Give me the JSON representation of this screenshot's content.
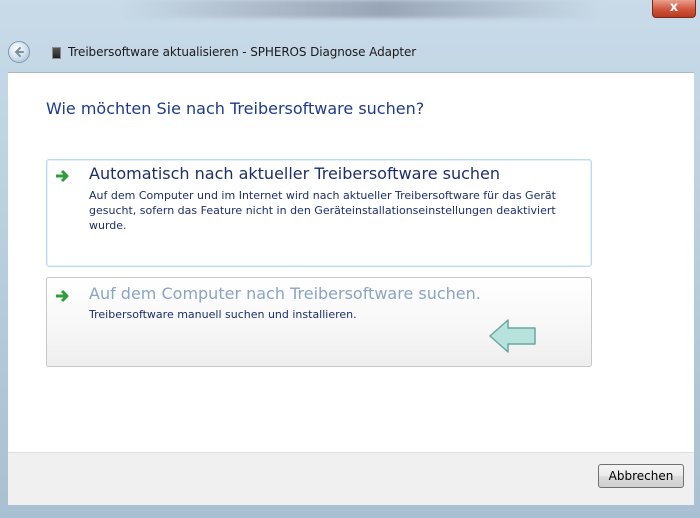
{
  "window": {
    "title": "Treibersoftware aktualisieren - SPHEROS Diagnose Adapter",
    "close_glyph": "x"
  },
  "content": {
    "heading": "Wie möchten Sie nach Treibersoftware suchen?"
  },
  "options": [
    {
      "title": "Automatisch nach aktueller Treibersoftware suchen",
      "description": "Auf dem Computer und im Internet wird nach aktueller Treibersoftware für das Gerät gesucht, sofern das Feature nicht in den Geräteinstallationseinstellungen deaktiviert wurde."
    },
    {
      "title": "Auf dem Computer nach Treibersoftware suchen.",
      "description": "Treibersoftware manuell suchen und installieren."
    }
  ],
  "footer": {
    "cancel_label": "Abbrechen"
  },
  "colors": {
    "heading": "#1e3a8a",
    "arrow_green": "#2e9e3a",
    "hint_arrow_fill": "#b8e2dc",
    "hint_arrow_stroke": "#6aa6a0"
  },
  "icons": {
    "back": "back-arrow-icon",
    "option_arrow": "green-arrow-icon",
    "hint": "left-arrow-hint-icon"
  }
}
